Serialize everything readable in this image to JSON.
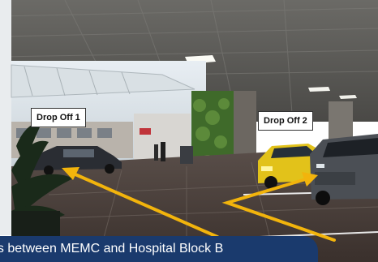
{
  "labels": {
    "drop_off_1": "Drop Off 1",
    "drop_off_2": "Drop Off 2"
  },
  "caption": "ns between MEMC and Hospital Block B",
  "colors": {
    "arrow": "#f2b40c",
    "caption_bg": "#1a3a6d"
  }
}
